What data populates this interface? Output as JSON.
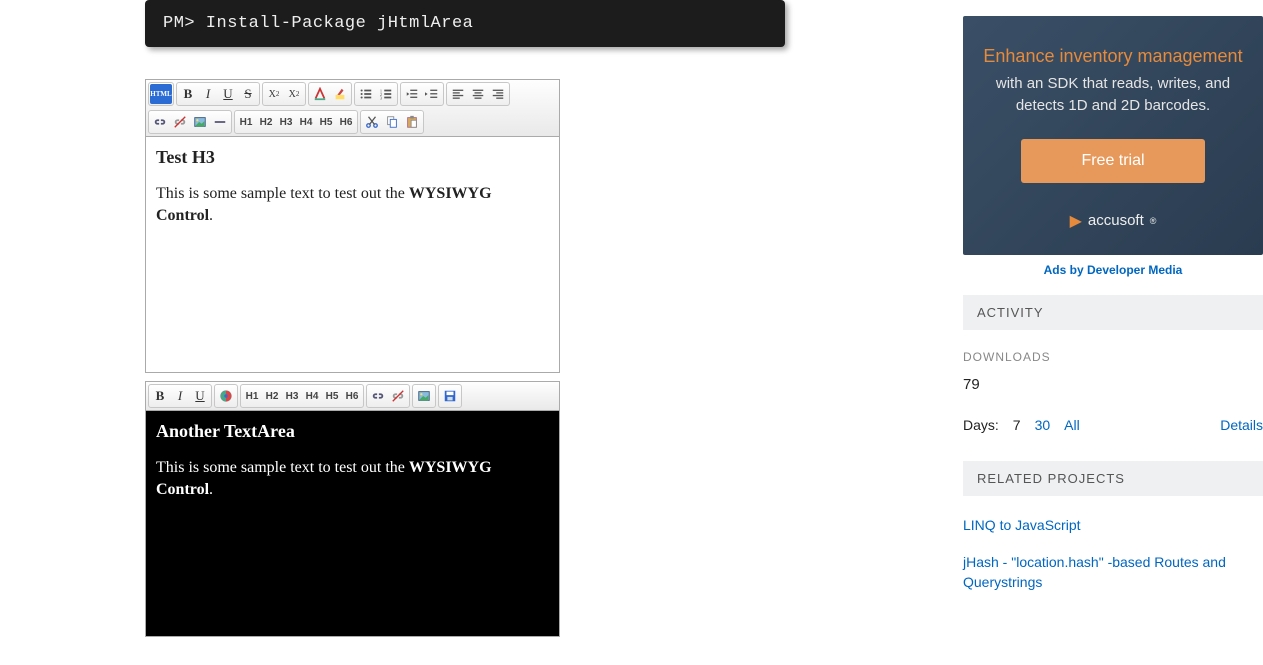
{
  "terminal": {
    "command": "PM> Install-Package jHtmlArea"
  },
  "editor1": {
    "toolbar": {
      "html": "HTML",
      "h": [
        "H1",
        "H2",
        "H3",
        "H4",
        "H5",
        "H6"
      ]
    },
    "heading": "Test H3",
    "text_before": "This is some sample text to test out the ",
    "text_bold": "WYSIWYG Control",
    "text_after": "."
  },
  "editor2": {
    "toolbar": {
      "h": [
        "H1",
        "H2",
        "H3",
        "H4",
        "H5",
        "H6"
      ]
    },
    "heading": "Another TextArea",
    "text_before": "This is some sample text to test out the ",
    "text_bold": "WYSIWYG Control",
    "text_after": "."
  },
  "ad": {
    "headline": "Enhance inventory management",
    "sub": "with an SDK that reads, writes, and detects 1D and 2D barcodes.",
    "cta": "Free trial",
    "brand": "accusoft",
    "ads_by": "Ads by Developer Media"
  },
  "activity": {
    "header": "ACTIVITY",
    "downloads_label": "DOWNLOADS",
    "downloads_count": "79",
    "days_label": "Days:",
    "days_7": "7",
    "days_30": "30",
    "days_all": "All",
    "details": "Details"
  },
  "related": {
    "header": "RELATED PROJECTS",
    "items": [
      "LINQ to JavaScript",
      "jHash - \"location.hash\" -based Routes and Querystrings"
    ]
  }
}
